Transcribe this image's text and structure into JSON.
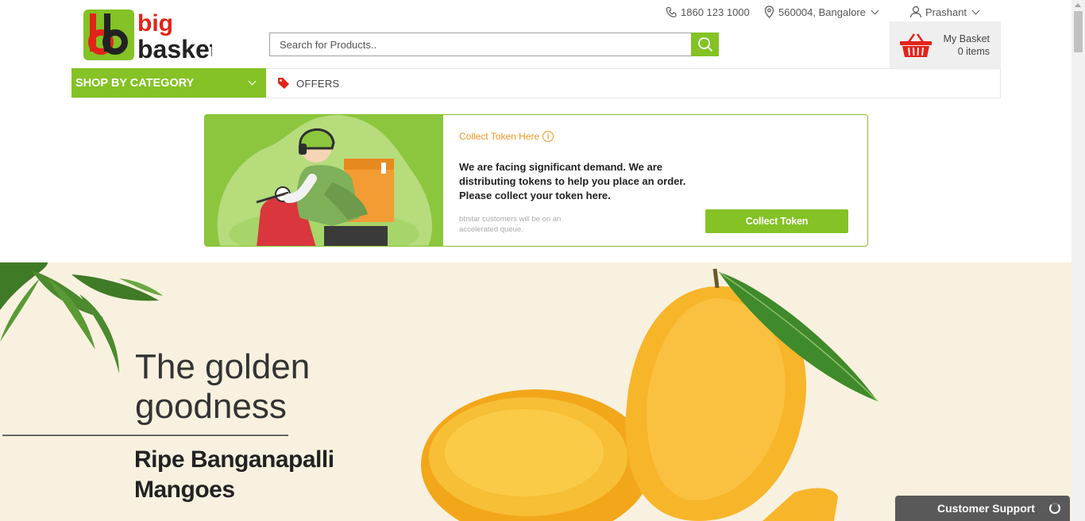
{
  "header": {
    "brand_line1": "big",
    "brand_line2": "basket",
    "phone": "1860 123 1000",
    "location": "560004, Bangalore",
    "user": "Prashant",
    "search_placeholder": "Search for Products..",
    "basket_label": "My Basket",
    "basket_count": "0 items"
  },
  "nav": {
    "shop_by_category": "SHOP BY CATEGORY",
    "offers": "OFFERS"
  },
  "token_card": {
    "title": "Collect Token Here",
    "message": "We are facing significant demand. We are distributing tokens to help you place an order. Please collect your token here.",
    "note": "bbstar customers will be on an accelerated queue.",
    "button": "Collect Token"
  },
  "hero": {
    "heading": "The golden goodness",
    "subheading": "Ripe Banganapalli Mangoes"
  },
  "support": {
    "label": "Customer Support"
  },
  "colors": {
    "brand_green": "#84c225",
    "brand_red": "#e2231a",
    "accent_orange": "#f7931e",
    "hero_bg": "#f8f1df"
  },
  "icons": [
    "phone-icon",
    "location-icon",
    "user-icon",
    "search-icon",
    "basket-icon",
    "tag-icon",
    "info-icon",
    "spinner-icon"
  ]
}
